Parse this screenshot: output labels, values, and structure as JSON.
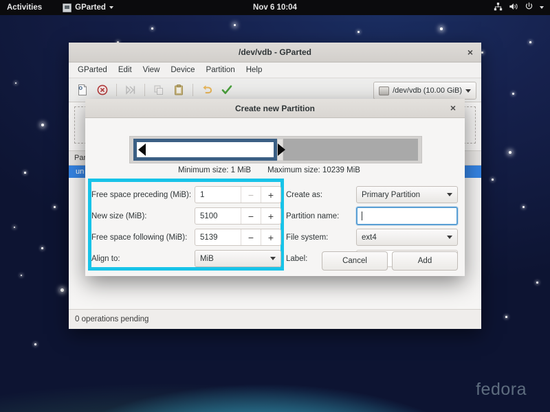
{
  "topbar": {
    "activities": "Activities",
    "app_name": "GParted",
    "clock": "Nov 6  10:04",
    "icons": [
      "network-icon",
      "volume-icon",
      "power-icon",
      "chevron-down-icon"
    ]
  },
  "main_window": {
    "title": "/dev/vdb - GParted",
    "close_label": "×",
    "menus": [
      "GParted",
      "Edit",
      "View",
      "Device",
      "Partition",
      "Help"
    ],
    "toolbar_icons": [
      "new-partition-icon",
      "delete-partition-icon",
      "resize-move-icon",
      "copy-icon",
      "paste-icon",
      "undo-icon",
      "apply-icon"
    ],
    "device_selector": "/dev/vdb (10.00 GiB)",
    "list_header": "Part",
    "selected_row": "un",
    "statusbar": "0 operations pending"
  },
  "dialog": {
    "title": "Create new Partition",
    "close_label": "×",
    "minimum_size": "Minimum size: 1 MiB",
    "maximum_size": "Maximum size: 10239 MiB",
    "left_fields": {
      "free_preceding_label": "Free space preceding (MiB):",
      "free_preceding_value": "1",
      "new_size_label": "New size (MiB):",
      "new_size_value": "5100",
      "free_following_label": "Free space following (MiB):",
      "free_following_value": "5139",
      "align_label": "Align to:",
      "align_value": "MiB"
    },
    "right_fields": {
      "create_as_label": "Create as:",
      "create_as_value": "Primary Partition",
      "partition_name_label": "Partition name:",
      "partition_name_value": "",
      "file_system_label": "File system:",
      "file_system_value": "ext4",
      "partition_label_label": "Label:",
      "partition_label_value": ""
    },
    "spin_minus": "−",
    "spin_plus": "+",
    "buttons": {
      "cancel": "Cancel",
      "add": "Add"
    }
  },
  "desktop": {
    "watermark": "fedora"
  },
  "colors": {
    "highlight": "#17c3e8",
    "selection_blue": "#3584e4",
    "partition_border": "#3b5f84",
    "unallocated_grey": "#a9a9a9"
  }
}
